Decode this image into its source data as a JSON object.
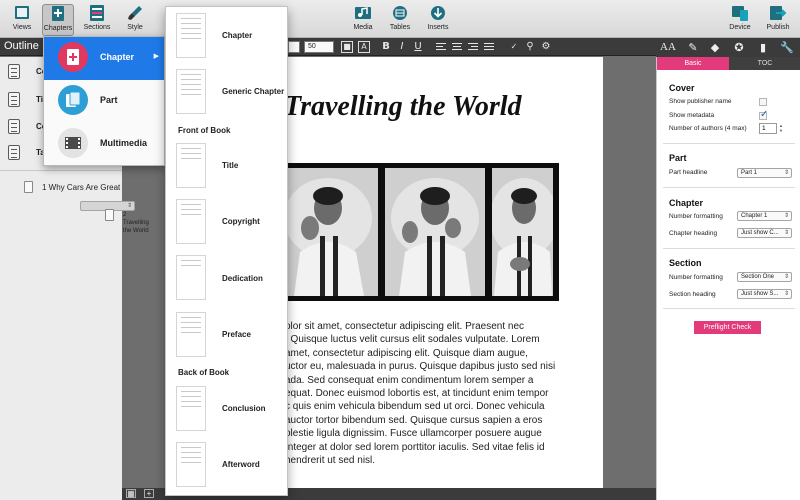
{
  "toolbar": {
    "views": "Views",
    "chapters": "Chapters",
    "sections": "Sections",
    "style": "Style",
    "media": "Media",
    "tables": "Tables",
    "inserts": "Inserts",
    "device": "Device",
    "publish": "Publish"
  },
  "formatbar": {
    "font_size": "50"
  },
  "sidebar": {
    "title": "Outline",
    "partial_labels": [
      "Co",
      "Tit",
      "Co",
      "Ta"
    ],
    "chapters": [
      {
        "label": "1  Why Cars Are Great"
      },
      {
        "label": "2  Travelling the World"
      }
    ]
  },
  "chapters_menu": {
    "items": [
      {
        "label": "Chapter",
        "icon": "chapter-icon",
        "selected": true
      },
      {
        "label": "Part",
        "icon": "part-icon"
      },
      {
        "label": "Multimedia",
        "icon": "multimedia-icon"
      }
    ]
  },
  "template_menu": {
    "items": [
      {
        "label": "Chapter"
      },
      {
        "label": "Generic Chapter"
      },
      {
        "heading": "Front of Book"
      },
      {
        "label": "Title"
      },
      {
        "label": "Copyright"
      },
      {
        "label": "Dedication"
      },
      {
        "label": "Preface"
      },
      {
        "heading": "Back of Book"
      },
      {
        "label": "Conclusion"
      },
      {
        "label": "Afterword"
      }
    ]
  },
  "document": {
    "title": "Travelling the World",
    "body_lines": [
      "olor sit amet, consectetur adipiscing elit. Praesent nec",
      ". Quisque luctus velit cursus elit sodales vulputate. Lorem",
      "amet, consectetur adipiscing elit. Quisque diam augue,",
      "uctor eu, malesuada in purus. Quisque dapibus justo sed nisi",
      "ada. Sed consequat enim condimentum lorem semper a",
      "equat. Donec euismod lobortis est, at tincidunt enim tempor",
      "c quis enim vehicula bibendum sed ut orci. Donec vehicula",
      "auctor tortor bibendum sed. Quisque cursus sapien a eros",
      "olestie ligula dignissim. Fusce ullamcorper posuere augue",
      "Integer at dolor sed lorem porttitor iaculis. Sed vitae felis id",
      "hendrerit ut sed nisl."
    ]
  },
  "panel": {
    "tab_basic": "Basic",
    "tab_toc": "TOC",
    "cover": {
      "title": "Cover",
      "show_publisher_name": "Show publisher name",
      "show_metadata": "Show metadata",
      "number_of_authors": "Number of authors (4 max)",
      "authors_value": "1"
    },
    "part": {
      "title": "Part",
      "part_headline": "Part headline",
      "part_headline_value": "Part 1"
    },
    "chapter": {
      "title": "Chapter",
      "number_formatting": "Number formatting",
      "number_formatting_value": "Chapter 1",
      "chapter_heading": "Chapter heading",
      "chapter_heading_value": "Just show C..."
    },
    "section": {
      "title": "Section",
      "number_formatting": "Number formatting",
      "number_formatting_value": "Section One",
      "section_heading": "Section heading",
      "section_heading_value": "Just show S..."
    },
    "preflight": "Preflight Check"
  },
  "colors": {
    "accent": "#e23a7a",
    "selection": "#1f7ae8",
    "dark_bar": "#3b3b3b"
  }
}
